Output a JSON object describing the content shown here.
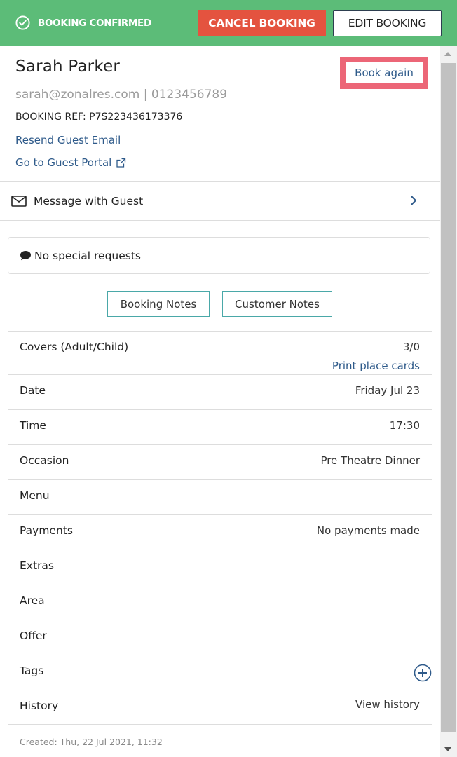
{
  "header": {
    "status": "BOOKING CONFIRMED",
    "cancel_label": "CANCEL BOOKING",
    "edit_label": "EDIT BOOKING"
  },
  "guest": {
    "name": "Sarah Parker",
    "contact": "sarah@zonalres.com | 0123456789",
    "booking_ref": "BOOKING REF: P7S223436173376",
    "resend_email": "Resend Guest Email",
    "guest_portal": "Go to Guest Portal",
    "book_again": "Book again"
  },
  "message": {
    "label": "Message with Guest"
  },
  "special_requests": "No special requests",
  "notes": {
    "booking": "Booking Notes",
    "customer": "Customer Notes"
  },
  "details": {
    "covers": {
      "label": "Covers (Adult/Child)",
      "value": "3/0",
      "link": "Print place cards"
    },
    "date": {
      "label": "Date",
      "value": "Friday Jul 23"
    },
    "time": {
      "label": "Time",
      "value": "17:30"
    },
    "occasion": {
      "label": "Occasion",
      "value": "Pre Theatre Dinner"
    },
    "menu": {
      "label": "Menu",
      "value": ""
    },
    "payments": {
      "label": "Payments",
      "value": "No payments made"
    },
    "extras": {
      "label": "Extras",
      "value": ""
    },
    "area": {
      "label": "Area",
      "value": ""
    },
    "offer": {
      "label": "Offer",
      "value": ""
    },
    "tags": {
      "label": "Tags"
    },
    "history": {
      "label": "History",
      "link": "View history"
    }
  },
  "created": "Created: Thu, 22 Jul 2021, 11:32",
  "colors": {
    "header_green": "#5cbc78",
    "cancel_red": "#e4533f",
    "link_blue": "#2e5a8a",
    "highlight_pink": "#ec6677",
    "notes_border": "#4aa8a8"
  }
}
